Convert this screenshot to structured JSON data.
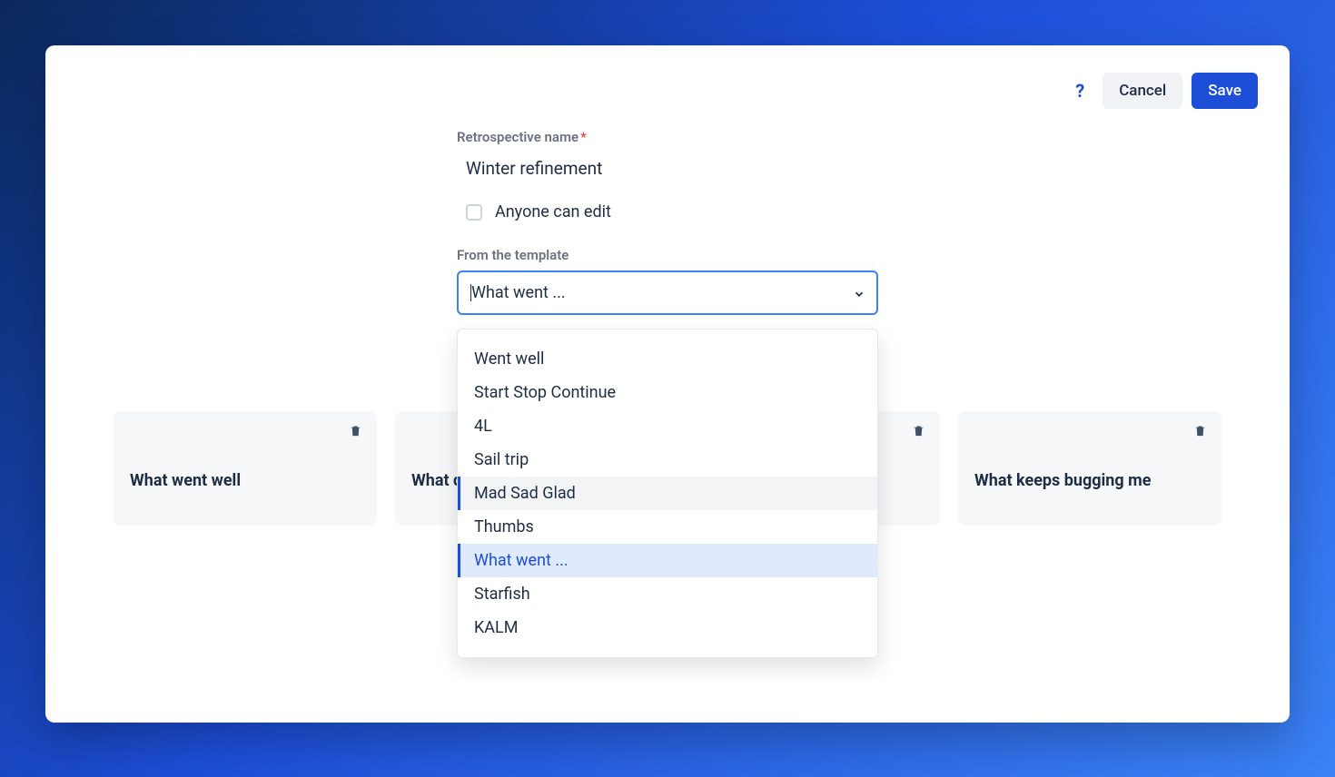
{
  "actions": {
    "cancel_label": "Cancel",
    "save_label": "Save"
  },
  "form": {
    "name_label": "Retrospective name",
    "name_value": "Winter refinement",
    "anyone_can_edit_label": "Anyone can edit",
    "template_label": "From the template",
    "template_selected": "What went ..."
  },
  "template_options": [
    {
      "label": "Went well",
      "state": "normal"
    },
    {
      "label": "Start Stop Continue",
      "state": "normal"
    },
    {
      "label": "4L",
      "state": "normal"
    },
    {
      "label": "Sail trip",
      "state": "normal"
    },
    {
      "label": "Mad Sad Glad",
      "state": "hovered"
    },
    {
      "label": "Thumbs",
      "state": "normal"
    },
    {
      "label": "What went ...",
      "state": "selected"
    },
    {
      "label": "Starfish",
      "state": "normal"
    },
    {
      "label": "KALM",
      "state": "normal"
    }
  ],
  "columns": [
    {
      "title": "What went well"
    },
    {
      "title": "What d"
    },
    {
      "title": ""
    },
    {
      "title": "What keeps bugging me"
    }
  ]
}
